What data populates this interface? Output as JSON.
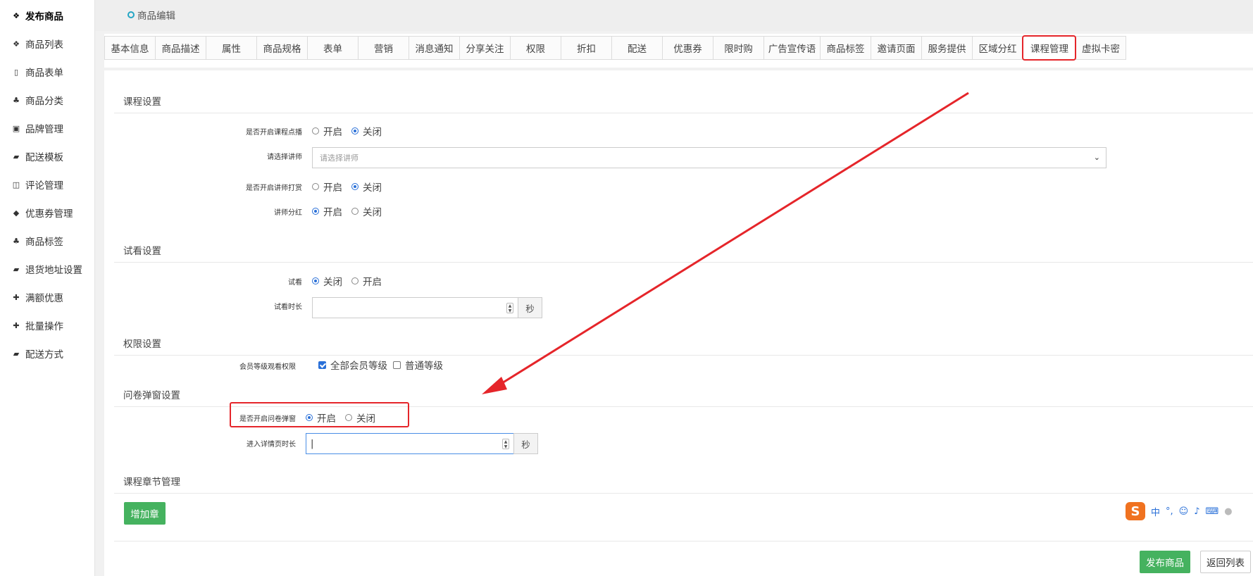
{
  "sidebar": {
    "items": [
      {
        "label": "发布商品",
        "icon": "cubes-icon"
      },
      {
        "label": "商品列表",
        "icon": "cubes-icon"
      },
      {
        "label": "商品表单",
        "icon": "file-icon"
      },
      {
        "label": "商品分类",
        "icon": "sitemap-icon"
      },
      {
        "label": "品牌管理",
        "icon": "briefcase-icon"
      },
      {
        "label": "配送模板",
        "icon": "truck-icon"
      },
      {
        "label": "评论管理",
        "icon": "columns-icon"
      },
      {
        "label": "优惠券管理",
        "icon": "tags-icon"
      },
      {
        "label": "商品标签",
        "icon": "sitemap-icon"
      },
      {
        "label": "退货地址设置",
        "icon": "truck-icon"
      },
      {
        "label": "满额优惠",
        "icon": "gift-icon"
      },
      {
        "label": "批量操作",
        "icon": "gift-icon"
      },
      {
        "label": "配送方式",
        "icon": "truck-icon"
      }
    ]
  },
  "breadcrumb": {
    "label": "商品编辑"
  },
  "tabs": [
    "基本信息",
    "商品描述",
    "属性",
    "商品规格",
    "表单",
    "营销",
    "消息通知",
    "分享关注",
    "权限",
    "折扣",
    "配送",
    "优惠券",
    "限时购",
    "广告宣传语",
    "商品标签",
    "邀请页面",
    "服务提供",
    "区域分红",
    "课程管理",
    "虚拟卡密"
  ],
  "sections": {
    "course": {
      "title": "课程设置",
      "reward_label": "是否开启课程点播",
      "lecturer_label": "请选择讲师",
      "lecturer_placeholder": "请选择讲师",
      "tip_label": "是否开启讲师打赏",
      "dividend_label": "讲师分红"
    },
    "trial": {
      "title": "试看设置",
      "trial_label": "试看",
      "duration_label": "试看时长",
      "unit": "秒"
    },
    "permission": {
      "title": "权限设置",
      "level_label": "会员等级观看权限",
      "all_levels": "全部会员等级",
      "normal_level": "普通等级"
    },
    "survey": {
      "title": "问卷弹窗设置",
      "popup_label": "是否开启问卷弹窗",
      "enter_label": "进入详情页时长",
      "unit": "秒"
    },
    "chapter": {
      "title": "课程章节管理",
      "add_button": "增加章"
    }
  },
  "options": {
    "on": "开启",
    "off": "关闭"
  },
  "footer": {
    "publish": "发布商品",
    "back": "返回列表"
  },
  "ime": {
    "lang": "中",
    "punct": "°,"
  },
  "colors": {
    "accent_green": "#45b25f",
    "highlight_red": "#e5252a",
    "radio_blue": "#2a70d8"
  }
}
